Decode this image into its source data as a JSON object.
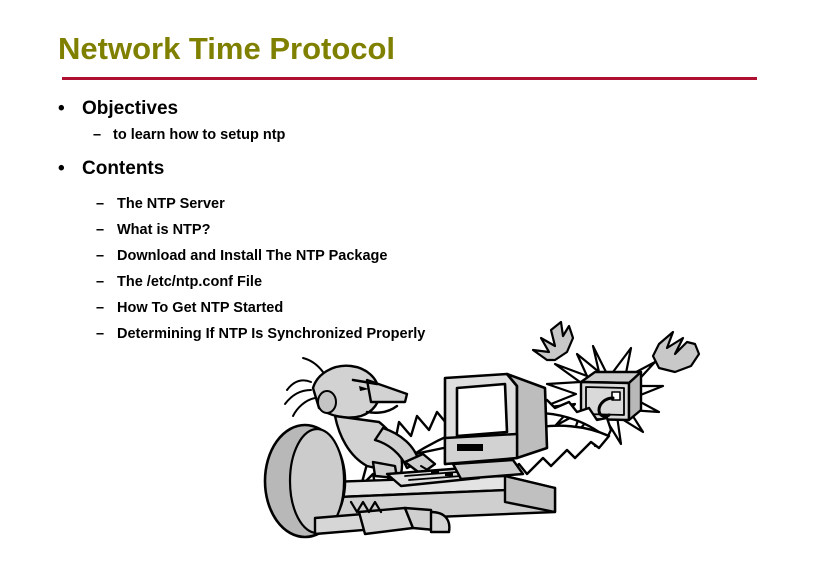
{
  "slide": {
    "title": "Network Time Protocol",
    "title_color": "#808000",
    "rule_color": "#b01030",
    "background_color": "#ffffff",
    "text_color": "#000000"
  },
  "outline": {
    "bullet_glyph": "•",
    "dash_glyph": "–",
    "sections": [
      {
        "heading": "Objectives",
        "items": [
          "to learn how to setup ntp"
        ]
      },
      {
        "heading": "Contents",
        "items": [
          "The NTP Server",
          "What is NTP?",
          "Download and Install The NTP Package",
          "The /etc/ntp.conf File",
          "How To Get NTP Started",
          "Determining If NTP Is Synchronized Properly"
        ]
      }
    ]
  },
  "clipart": {
    "description": "Cartoon of a frustrated man at a desktop computer connected by a jagged lightning bolt to an exploding computer",
    "parts": [
      "person-at-computer",
      "crt-monitor",
      "keyboard",
      "desk",
      "office-chair",
      "lightning-connection",
      "exploding-computer",
      "raised-hands"
    ],
    "fill_light": "#d9d9d9",
    "fill_mid": "#bfbfbf",
    "outline": "#000000"
  }
}
